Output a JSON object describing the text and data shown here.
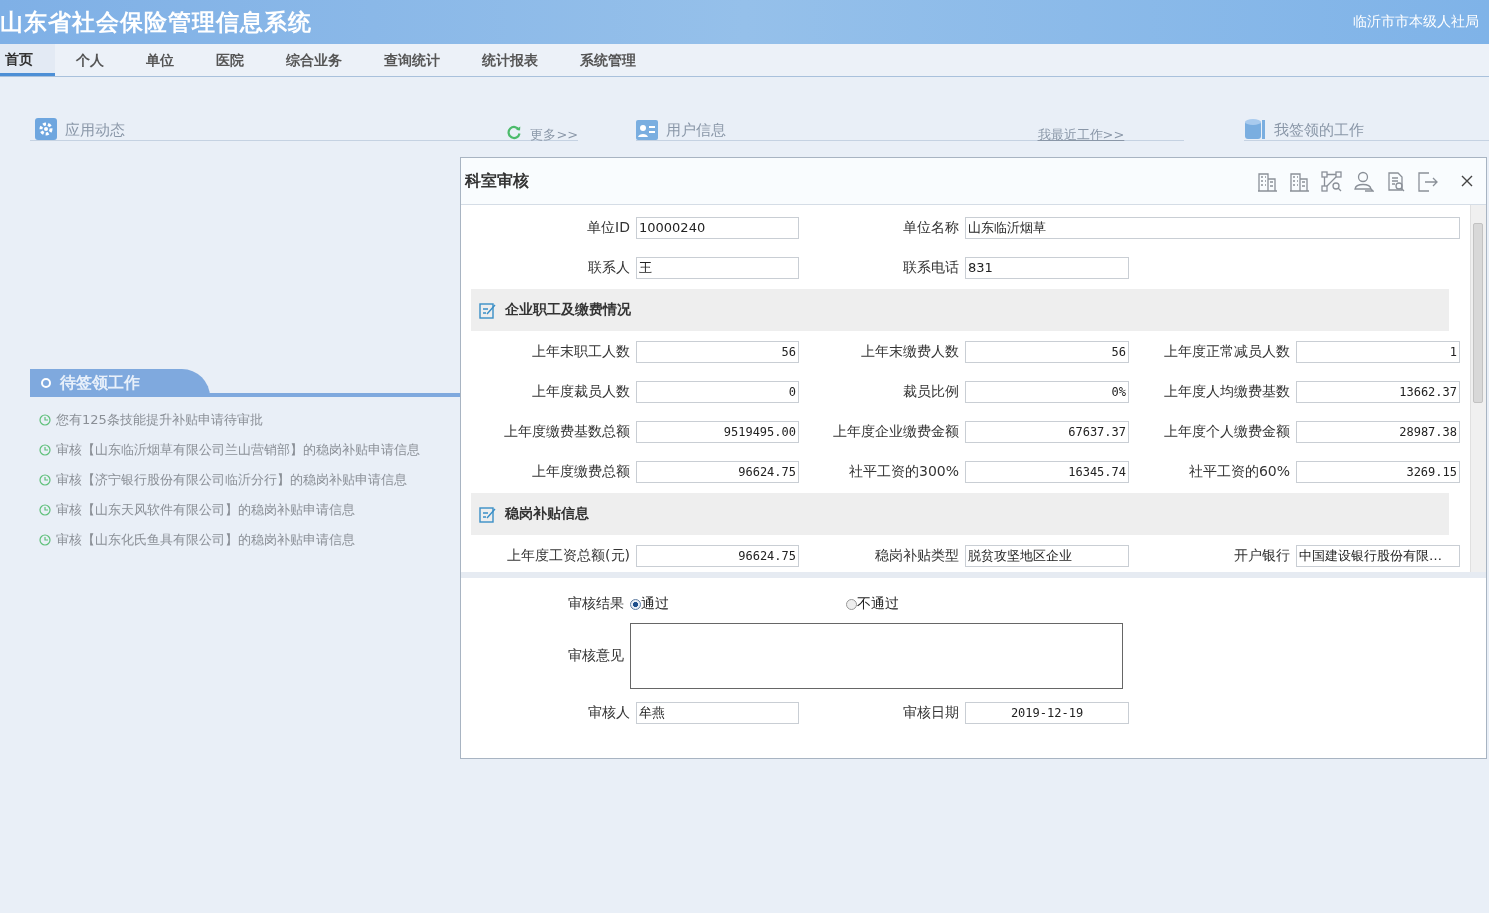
{
  "header": {
    "title": "山东省社会保险管理信息系统",
    "org": "临沂市市本级人社局"
  },
  "nav": [
    {
      "label": "首页",
      "selected": true
    },
    {
      "label": "个人",
      "selected": false
    },
    {
      "label": "单位",
      "selected": false
    },
    {
      "label": "医院",
      "selected": false
    },
    {
      "label": "综合业务",
      "selected": false
    },
    {
      "label": "查询统计",
      "selected": false
    },
    {
      "label": "统计报表",
      "selected": false
    },
    {
      "label": "系统管理",
      "selected": false
    }
  ],
  "panels": {
    "app_news": {
      "title": "应用动态",
      "more": "更多>>"
    },
    "user_info": {
      "title": "用户信息",
      "more": "我最近工作>>"
    },
    "my_work": {
      "title": "我签领的工作"
    }
  },
  "pending": {
    "title": "待签领工作",
    "items": [
      "您有125条技能提升补贴申请待审批",
      "审核【山东临沂烟草有限公司兰山营销部】的稳岗补贴申请信息",
      "审核【济宁银行股份有限公司临沂分行】的稳岗补贴申请信息",
      "审核【山东天风软件有限公司】的稳岗补贴申请信息",
      "审核【山东化氏鱼具有限公司】的稳岗补贴申请信息"
    ]
  },
  "dialog": {
    "title": "科室审核",
    "rows": [
      {
        "kind": "fields",
        "fields": [
          {
            "label": "单位ID",
            "value": "10000240",
            "kind": "text"
          },
          {
            "label": "单位名称",
            "value": "山东临沂烟草",
            "kind": "wide"
          }
        ]
      },
      {
        "kind": "fields",
        "fields": [
          {
            "label": "联系人",
            "value": "王",
            "kind": "text"
          },
          {
            "label": "联系电话",
            "value": "831",
            "kind": "text"
          }
        ]
      },
      {
        "kind": "section",
        "title": "企业职工及缴费情况"
      },
      {
        "kind": "fields",
        "fields": [
          {
            "label": "上年末职工人数",
            "value": "56",
            "kind": "number"
          },
          {
            "label": "上年末缴费人数",
            "value": "56",
            "kind": "number"
          },
          {
            "label": "上年度正常减员人数",
            "value": "1",
            "kind": "number"
          }
        ]
      },
      {
        "kind": "fields",
        "fields": [
          {
            "label": "上年度裁员人数",
            "value": "0",
            "kind": "number"
          },
          {
            "label": "裁员比例",
            "value": "0%",
            "kind": "number"
          },
          {
            "label": "上年度人均缴费基数",
            "value": "13662.37",
            "kind": "number"
          }
        ]
      },
      {
        "kind": "fields",
        "fields": [
          {
            "label": "上年度缴费基数总额",
            "value": "9519495.00",
            "kind": "number"
          },
          {
            "label": "上年度企业缴费金额",
            "value": "67637.37",
            "kind": "number"
          },
          {
            "label": "上年度个人缴费金额",
            "value": "28987.38",
            "kind": "number"
          }
        ]
      },
      {
        "kind": "fields",
        "fields": [
          {
            "label": "上年度缴费总额",
            "value": "96624.75",
            "kind": "number"
          },
          {
            "label": "社平工资的300%",
            "value": "16345.74",
            "kind": "number"
          },
          {
            "label": "社平工资的60%",
            "value": "3269.15",
            "kind": "number"
          }
        ]
      },
      {
        "kind": "section",
        "title": "稳岗补贴信息"
      },
      {
        "kind": "fields",
        "fields": [
          {
            "label": "上年度工资总额(元)",
            "value": "96624.75",
            "kind": "number"
          },
          {
            "label": "稳岗补贴类型",
            "value": "脱贫攻坚地区企业",
            "kind": "text"
          },
          {
            "label": "开户银行",
            "value": "中国建设银行股份有限…",
            "kind": "text"
          }
        ]
      }
    ],
    "review": {
      "result_label": "审核结果",
      "options": [
        {
          "label": "通过",
          "selected": true
        },
        {
          "label": "不通过",
          "selected": false
        }
      ],
      "comment_label": "审核意见",
      "reviewer_label": "审核人",
      "reviewer": "牟燕",
      "date_label": "审核日期",
      "date": "2019-12-19"
    }
  }
}
